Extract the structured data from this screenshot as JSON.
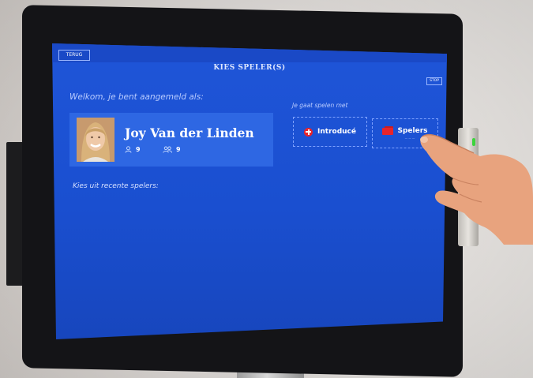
{
  "header": {
    "back_label": "TERUG",
    "title": "KIES SPELER(S)",
    "stop_label": "STOP"
  },
  "welcome_text": "Welkom, je bent aangemeld als:",
  "user": {
    "name": "Joy Van der Linden",
    "stat_one": "9",
    "stat_two": "9"
  },
  "play_with": {
    "label": "Je gaat spelen met",
    "introduce_label": "Introducé",
    "spelers_label": "Spelers"
  },
  "recent_players_label": "Kies uit recente spelers:",
  "colors": {
    "screen_blue": "#1f55d8",
    "card_blue": "#2e67e3",
    "accent_red": "#e8242a"
  },
  "icons": [
    "person-icon",
    "group-icon",
    "plus-circle-icon",
    "cards-icon"
  ]
}
